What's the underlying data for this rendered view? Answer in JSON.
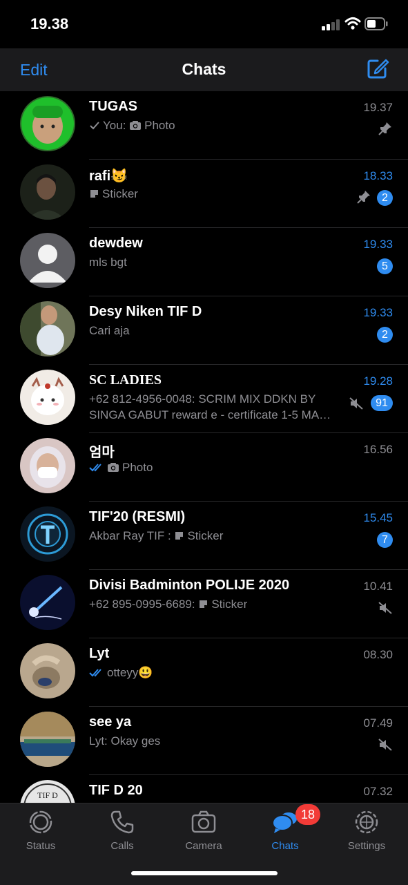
{
  "status": {
    "time": "19.38"
  },
  "nav": {
    "edit_label": "Edit",
    "title": "Chats"
  },
  "chats": [
    {
      "name": "TUGAS",
      "preview_prefix": "You: ",
      "preview": "Photo",
      "time": "19.37",
      "pinned": true
    },
    {
      "name": "rafi😼",
      "preview": "Sticker",
      "time": "18.33",
      "pinned": true,
      "unread": "2"
    },
    {
      "name": "dewdew",
      "preview": "mls bgt",
      "time": "19.33",
      "unread": "5"
    },
    {
      "name": "Desy Niken TIF D",
      "preview": "Cari aja",
      "time": "19.33",
      "unread": "2"
    },
    {
      "name": "SC LADIES",
      "preview": "+62 812-4956-0048: SCRIM MIX DDKN BY SINGA GABUT reward e - certificate 1-5 MA…",
      "time": "19.28",
      "muted": true,
      "unread": "91"
    },
    {
      "name": "엄마",
      "preview": "Photo",
      "time": "16.56"
    },
    {
      "name": "TIF'20 (RESMI)",
      "preview_prefix": "Akbar Ray TIF : ",
      "preview": "Sticker",
      "time": "15.45",
      "unread": "7"
    },
    {
      "name": "Divisi Badminton POLIJE 2020",
      "preview_prefix": "+62 895-0995-6689: ",
      "preview": "Sticker",
      "time": "10.41",
      "muted": true
    },
    {
      "name": "Lyt",
      "preview": "otteyy😃",
      "time": "08.30"
    },
    {
      "name": "see ya",
      "preview": "Lyt: Okay ges",
      "time": "07.49",
      "muted": true
    },
    {
      "name": "TIF D 20",
      "preview": "",
      "time": "07.32"
    }
  ],
  "avatar_text": {
    "tif_d_20": "TIF D"
  },
  "tabbar": {
    "tabs": [
      {
        "label": "Status",
        "icon": "status-icon"
      },
      {
        "label": "Calls",
        "icon": "phone-icon"
      },
      {
        "label": "Camera",
        "icon": "camera-icon"
      },
      {
        "label": "Chats",
        "icon": "chat-bubbles-icon",
        "active": true
      },
      {
        "label": "Settings",
        "icon": "gear-icon"
      }
    ],
    "chats_badge": "18"
  },
  "colors": {
    "accent": "#2f8cf0",
    "badge_red": "#f23b37",
    "secondary_text": "#8e8e93"
  }
}
